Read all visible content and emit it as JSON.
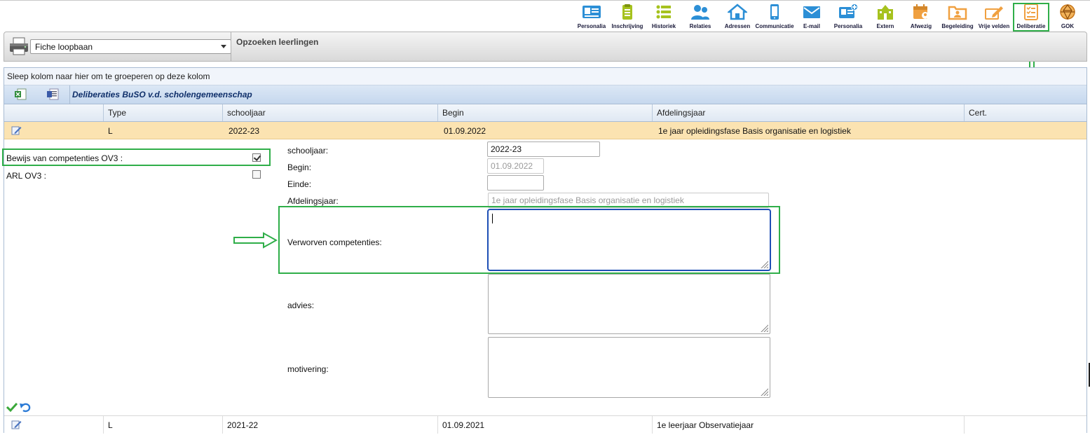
{
  "toolbar": {
    "items": [
      {
        "label": "Personalia",
        "icon": "id-card-icon",
        "color": "#2c8fd6"
      },
      {
        "label": "Inschrijving",
        "icon": "clipboard-icon",
        "color": "#a6c21e"
      },
      {
        "label": "Historiek",
        "icon": "list-icon",
        "color": "#a6c21e"
      },
      {
        "label": "Relaties",
        "icon": "people-icon",
        "color": "#2c8fd6"
      },
      {
        "label": "Adressen",
        "icon": "house-icon",
        "color": "#2c8fd6"
      },
      {
        "label": "Communicatie",
        "icon": "phone-icon",
        "color": "#2c8fd6"
      },
      {
        "label": "E-mail",
        "icon": "envelope-icon",
        "color": "#2c8fd6"
      },
      {
        "label": "Personalia",
        "icon": "id-card-plus-icon",
        "color": "#2c8fd6"
      },
      {
        "label": "Extern",
        "icon": "school-icon",
        "color": "#a6c21e"
      },
      {
        "label": "Afwezig",
        "icon": "calendar-user-icon",
        "color": "#f0a040"
      },
      {
        "label": "Begeleiding",
        "icon": "folder-user-icon",
        "color": "#f0a040"
      },
      {
        "label": "Vrije velden",
        "icon": "edit-pencil-icon",
        "color": "#f0a040"
      },
      {
        "label": "Deliberatie",
        "icon": "checklist-icon",
        "color": "#f0a040"
      },
      {
        "label": "GOK",
        "icon": "globe-icon",
        "color": "#e08a2a"
      }
    ]
  },
  "subbar": {
    "fiche_value": "Fiche loopbaan",
    "search_title": "Opzoeken leerlingen"
  },
  "grid": {
    "group_hint": "Sleep kolom naar hier om te groeperen op deze kolom",
    "caption": "Deliberaties BuSO v.d. scholengemeenschap",
    "columns": [
      "Type",
      "schooljaar",
      "Begin",
      "Afdelingsjaar",
      "Cert."
    ],
    "rows": [
      {
        "type": "L",
        "schooljaar": "2022-23",
        "begin": "01.09.2022",
        "afdelingsjaar": "1e jaar opleidingsfase Basis organisatie en logistiek",
        "cert": ""
      },
      {
        "type": "L",
        "schooljaar": "2021-22",
        "begin": "01.09.2021",
        "afdelingsjaar": "1e leerjaar Observatiejaar",
        "cert": ""
      }
    ]
  },
  "detail": {
    "checkboxes": [
      {
        "label": "Bewijs van competenties OV3 :",
        "checked": true
      },
      {
        "label": "ARL OV3 :",
        "checked": false
      }
    ],
    "schooljaar_label": "schooljaar:",
    "schooljaar_value": "2022-23",
    "begin_label": "Begin:",
    "begin_value": "01.09.2022",
    "einde_label": "Einde:",
    "einde_value": "",
    "afdelingsjaar_label": "Afdelingsjaar:",
    "afdelingsjaar_value": "1e jaar opleidingsfase Basis organisatie en logistiek",
    "verworven_label": "Verworven competenties:",
    "advies_label": "advies:",
    "motivering_label": "motivering:"
  },
  "colors": {
    "highlight": "#2fae49",
    "selected_row": "#fbe3b1",
    "focus_border": "#1e4fb5"
  }
}
